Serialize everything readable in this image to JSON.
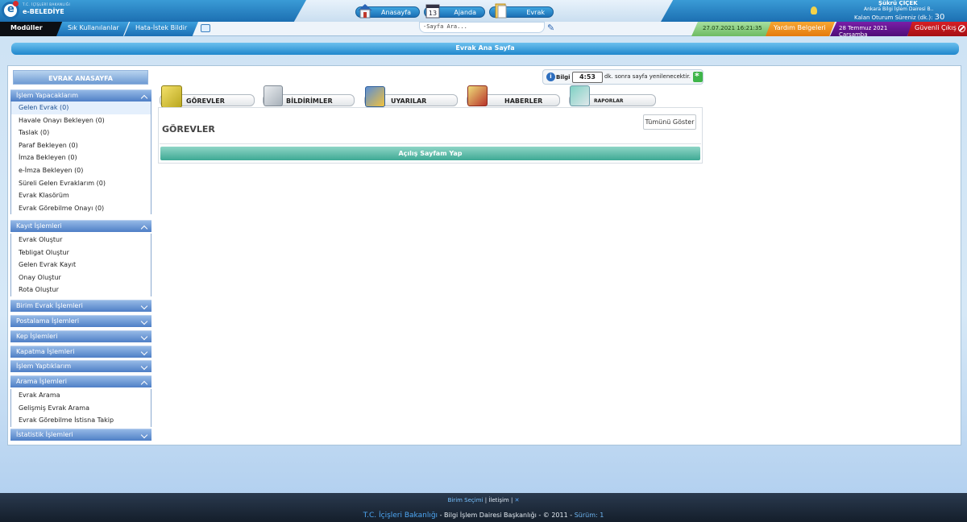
{
  "header": {
    "logo_small": "T.C. İÇİŞLERİ BAKANLIĞI",
    "logo_text": "e-BELEDİYE",
    "nav": [
      {
        "label": "Anasayfa"
      },
      {
        "label": "Ajanda"
      },
      {
        "label": "Evrak"
      }
    ],
    "user_name": "Şükrü ÇİÇEK",
    "user_unit": "Ankara Bilgi İşlem Dairesi B..",
    "session_label": "Kalan Oturum Süreniz (dk.):",
    "session_value": "30"
  },
  "menubar": {
    "modules": "Modüller",
    "frequent": "Sık Kullanılanlar",
    "error_report": "Hata-İstek Bildir",
    "search_placeholder": "-Sayfa Ara...",
    "datetime": "27.07.2021 16:21:35",
    "help_docs": "Yardım Belgeleri",
    "date_text": "28 Temmuz 2021 Çarşamba",
    "logout": "Güvenli Çıkış"
  },
  "page": {
    "title": "Evrak Ana Sayfa"
  },
  "sidebar": {
    "title": "EVRAK ANASAYFA",
    "sections": [
      {
        "label": "İşlem Yapacaklarım",
        "open": true,
        "items": [
          "Gelen Evrak (0)",
          "Havale Onayı Bekleyen (0)",
          "Taslak (0)",
          "Paraf Bekleyen (0)",
          "İmza Bekleyen (0)",
          "e-İmza Bekleyen (0)",
          "Süreli Gelen Evraklarım (0)",
          "Evrak Klasörüm",
          "Evrak Görebilme Onayı (0)"
        ]
      },
      {
        "label": "Kayıt İşlemleri",
        "open": true,
        "items": [
          "Evrak Oluştur",
          "Tebligat Oluştur",
          "Gelen Evrak Kayıt",
          "Onay Oluştur",
          "Rota Oluştur"
        ]
      },
      {
        "label": "Birim Evrak İşlemleri",
        "open": false,
        "items": []
      },
      {
        "label": "Postalama İşlemleri",
        "open": false,
        "items": []
      },
      {
        "label": "Kep İşlemleri",
        "open": false,
        "items": []
      },
      {
        "label": "Kapatma İşlemleri",
        "open": false,
        "items": []
      },
      {
        "label": "İşlem Yaptıklarım",
        "open": false,
        "items": []
      },
      {
        "label": "Arama İşlemleri",
        "open": true,
        "items": [
          "Evrak Arama",
          "Gelişmiş Evrak Arama",
          "Evrak Görebilme İstisna Takip"
        ]
      },
      {
        "label": "İstatistik İşlemleri",
        "open": false,
        "items": []
      }
    ]
  },
  "info": {
    "label": "Bilgi",
    "countdown": "4:53",
    "message": "dk. sonra sayfa yenilenecektir."
  },
  "tabs": [
    {
      "label": "GÖREVLER"
    },
    {
      "label": "BİLDİRİMLER"
    },
    {
      "label": "UYARILAR"
    },
    {
      "label": "HABERLER"
    },
    {
      "label": "RAPORLAR"
    }
  ],
  "panel": {
    "title": "GÖREVLER",
    "show_all": "Tümünü Göster",
    "set_home": "Açılış Sayfam Yap"
  },
  "footer": {
    "unit_select": "Birim Seçimi",
    "contact": "İletişim",
    "ministry": "T.C. İçişleri Bakanlığı",
    "dept": " - Bilgi İşlem Dairesi Başkanlığı - © 2011",
    "version": "Sürüm: 1"
  },
  "colors": {
    "primary_blue": "#1f87cc",
    "help_orange": "#e57a0c",
    "date_purple": "#4e0d77",
    "logout_red": "#a50f14",
    "clock_green": "#6dbb62",
    "set_home_teal": "#3ea994"
  }
}
